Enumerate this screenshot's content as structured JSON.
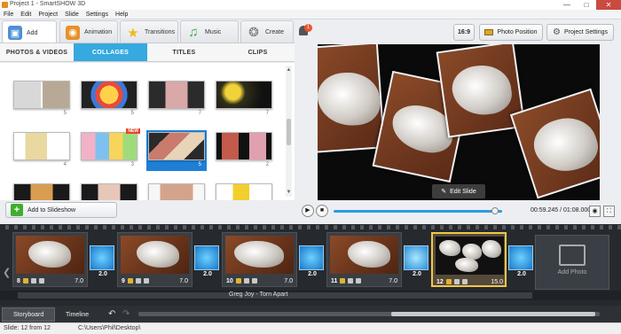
{
  "window": {
    "title": "Project 1 - SmartSHOW 3D",
    "controls": [
      "minimize-icon",
      "maximize-icon",
      "close-icon"
    ]
  },
  "menu": [
    "File",
    "Edit",
    "Project",
    "Slide",
    "Settings",
    "Help"
  ],
  "main_tabs": [
    {
      "label": "Add",
      "icon": "add-photos-icon",
      "active": true
    },
    {
      "label": "Animation",
      "icon": "animation-icon"
    },
    {
      "label": "Transitions",
      "icon": "star-icon"
    },
    {
      "label": "Music",
      "icon": "music-note-icon"
    },
    {
      "label": "Create",
      "icon": "film-reel-icon"
    }
  ],
  "sub_tabs": [
    {
      "label": "PHOTOS & VIDEOS"
    },
    {
      "label": "COLLAGES",
      "active": true
    },
    {
      "label": "TITLES"
    },
    {
      "label": "CLIPS"
    }
  ],
  "collages": [
    {
      "count": "5"
    },
    {
      "count": "5"
    },
    {
      "count": "7"
    },
    {
      "count": "7"
    },
    {
      "count": "4"
    },
    {
      "count": "3",
      "badge": "NEW"
    },
    {
      "count": "5",
      "selected": true
    },
    {
      "count": "2"
    },
    {
      "count": ""
    },
    {
      "count": ""
    },
    {
      "count": ""
    },
    {
      "count": ""
    }
  ],
  "add_to_slideshow": "Add to Slideshow",
  "notifications": {
    "count": "1"
  },
  "aspect_ratio": "16:9",
  "photo_position": "Photo Position",
  "project_settings": "Project Settings",
  "edit_slide": "Edit Slide",
  "player": {
    "timecode": "00:59.245 / 01:08.000",
    "progress": 0.96
  },
  "slides": [
    {
      "number": "8",
      "duration": "7.0",
      "transition": "2.0"
    },
    {
      "number": "9",
      "duration": "7.0",
      "transition": "2.0"
    },
    {
      "number": "10",
      "duration": "7.0",
      "transition": "2.0"
    },
    {
      "number": "11",
      "duration": "7.0",
      "transition": "2.0"
    },
    {
      "number": "12",
      "duration": "15.0",
      "transition": "2.0",
      "selected": true
    }
  ],
  "add_photo": "Add Photo",
  "audio_track": "Greg Joy - Torn Apart",
  "bottom_tabs": [
    {
      "label": "Storyboard",
      "active": true
    },
    {
      "label": "Timeline"
    }
  ],
  "status": {
    "slide": "Slide: 12 from 12",
    "path": "C:\\Users\\Phil\\Desktop\\"
  }
}
